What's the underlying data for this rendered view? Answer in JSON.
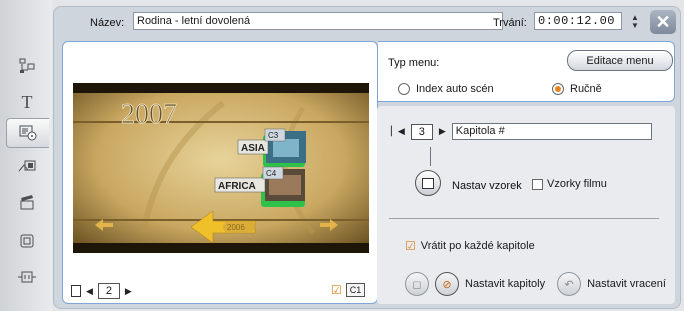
{
  "header": {
    "name_label": "Název:",
    "name_value": "Rodina - letní dovolená",
    "duration_label": "Trvání:",
    "duration_value": "0:00:12.00"
  },
  "toolstrip": {
    "items": [
      {
        "icon": "video-scene-icon"
      },
      {
        "icon": "title-text-icon"
      },
      {
        "icon": "disc-menu-icon"
      },
      {
        "icon": "transition-icon"
      },
      {
        "icon": "clapperboard-icon"
      },
      {
        "icon": "picture-in-picture-icon"
      },
      {
        "icon": "audio-plug-icon"
      }
    ],
    "active_index": 2
  },
  "preview": {
    "year_text": "2007",
    "chapters": [
      {
        "label": "ASIA",
        "tag": "C3"
      },
      {
        "label": "AFRICA",
        "tag": "C4"
      }
    ],
    "bottom_button_text": "2006",
    "page_number": "2",
    "chapter_tag": "C1"
  },
  "menu_type": {
    "label": "Typ menu:",
    "edit_button": "Editace menu",
    "option_auto": "Index auto scén",
    "option_manual": "Ručně",
    "selected": "Ručně"
  },
  "chapter_panel": {
    "chapter_number": "3",
    "chapter_name": "Kapitola #",
    "set_sample_label": "Nastav vzorek",
    "film_samples_label": "Vzorky filmu",
    "return_after_label": "Vrátit po každé kapitole",
    "set_chapters_label": "Nastavit kapitoly",
    "set_return_label": "Nastavit vracení"
  },
  "colors": {
    "accent_orange": "#e3851c",
    "panel_border": "#7fa6d8",
    "chapter_green": "#2fc24a"
  }
}
